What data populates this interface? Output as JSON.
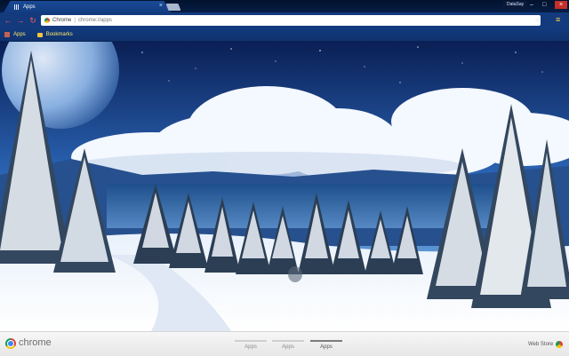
{
  "tab": {
    "title": "Apps",
    "close_icon": "close-icon",
    "favicon": "apps-grid-icon"
  },
  "window": {
    "profile": "DataSay",
    "minimize_icon": "minimize-icon",
    "maximize_icon": "maximize-icon",
    "close_icon": "close-icon"
  },
  "toolbar": {
    "back_icon": "arrow-left-icon",
    "forward_icon": "arrow-right-icon",
    "reload_icon": "reload-icon",
    "omnibox": {
      "scheme": "Chrome",
      "url": "chrome://apps"
    },
    "star_icon": "star-icon",
    "menu_icon": "menu-icon"
  },
  "bookmarks": [
    {
      "label": "Apps",
      "icon": "apps-grid-icon"
    },
    {
      "label": "Bookmarks",
      "icon": "folder-icon"
    }
  ],
  "footer": {
    "brand": "chrome",
    "pages": [
      {
        "label": "Apps",
        "active": false
      },
      {
        "label": "Apps",
        "active": false
      },
      {
        "label": "Apps",
        "active": true
      }
    ],
    "webstore": "Web Store"
  },
  "colors": {
    "accent": "#123a7d",
    "tab": "#1a4a96",
    "bookmark_text": "#ffe66b",
    "close_button": "#c4302b"
  }
}
